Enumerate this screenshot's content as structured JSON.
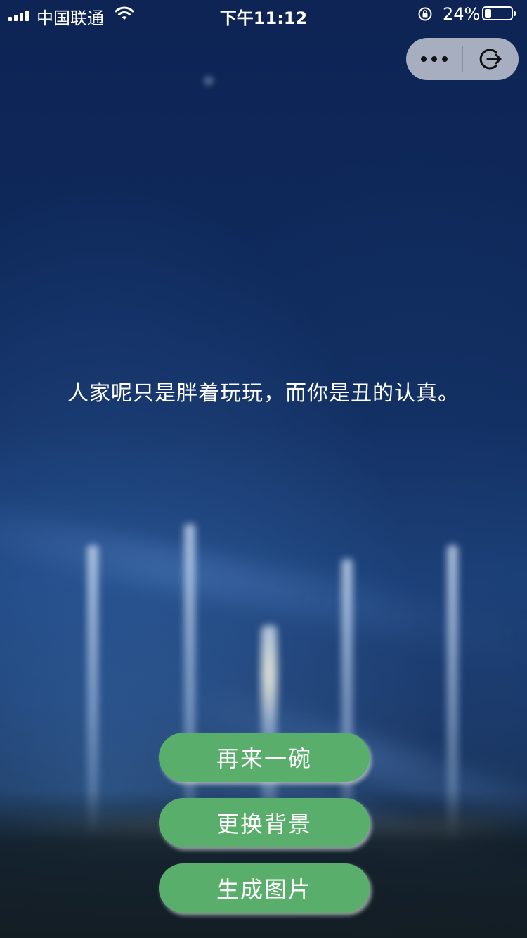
{
  "status_bar": {
    "carrier": "中国联通",
    "time": "下午11:12",
    "battery_percent_label": "24%",
    "battery_level": 0.24,
    "signal_bars": 4
  },
  "capsule": {
    "more_icon": "more-dots-icon",
    "exit_icon": "exit-icon"
  },
  "quote": {
    "text": "人家呢只是胖着玩玩，而你是丑的认真。"
  },
  "actions": {
    "again_label": "再来一碗",
    "change_bg_label": "更换背景",
    "generate_image_label": "生成图片"
  },
  "colors": {
    "button_green": "#58ae6a",
    "sky_blue": "#0f2c60",
    "text": "#ffffff"
  }
}
